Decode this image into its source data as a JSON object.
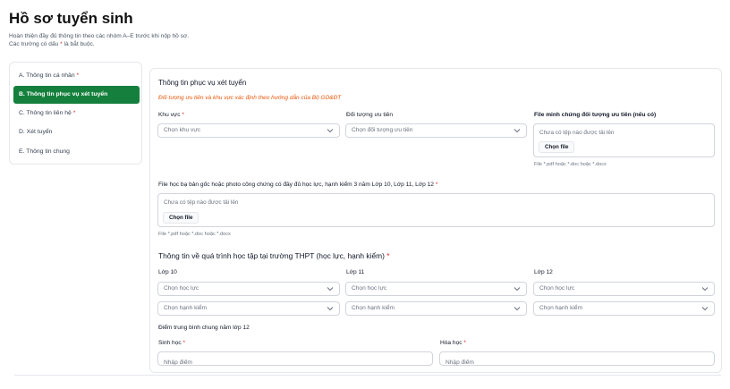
{
  "page": {
    "title": "Hồ sơ tuyển sinh",
    "desc_line1": "Hoàn thiện đầy đủ thông tin theo các nhóm A–E trước khi nộp hồ sơ.",
    "desc_line2_pre": "Các trường có dấu ",
    "desc_line2_star": "*",
    "desc_line2_post": " là bắt buộc."
  },
  "required_mark": "*",
  "sidebar": {
    "items": [
      {
        "label": "A. Thông tin cá nhân",
        "required": true
      },
      {
        "label": "B. Thông tin phục vụ xét tuyển",
        "active": true
      },
      {
        "label": "C. Thông tin liên hệ",
        "required": true
      },
      {
        "label": "D. Xét tuyển"
      },
      {
        "label": "E. Thông tin chung"
      }
    ]
  },
  "section1": {
    "title": "Thông tin phục vụ xét tuyển",
    "note": "Đối tượng ưu tiên và khu vực xác định theo hướng dẫn của Bộ GD&ĐT",
    "region_label": "Khu vực",
    "region_placeholder": "Chọn khu vực",
    "priority_label": "Đối tượng ưu tiên",
    "priority_placeholder": "Chọn đối tượng ưu tiên",
    "proof_label": "File minh chứng đối tượng ưu tiên (nếu có)",
    "proof_none": "Chưa có tệp nào được tải lên",
    "proof_button": "Chọn file",
    "proof_hint": "File *.pdf hoặc *.doc hoặc *.docx",
    "transcript_label": "File học bạ bản gốc hoặc photo công chứng có đầy đủ học lực, hạnh kiểm 3 năm Lớp 10, Lớp 11, Lớp 12",
    "transcript_none": "Chưa có tệp nào được tải lên",
    "transcript_button": "Chọn file",
    "transcript_hint": "File *.pdf hoặc *.doc hoặc *.docx"
  },
  "section2": {
    "title": "Thông tin về quá trình học tập tại trường THPT (học lực, hạnh kiểm)",
    "grades": [
      {
        "label": "Lớp 10",
        "academic_placeholder": "Chọn học lực",
        "conduct_placeholder": "Chọn hạnh kiểm"
      },
      {
        "label": "Lớp 11",
        "academic_placeholder": "Chọn học lực",
        "conduct_placeholder": "Chọn hạnh kiểm"
      },
      {
        "label": "Lớp 12",
        "academic_placeholder": "Chọn học lực",
        "conduct_placeholder": "Chọn hạnh kiểm"
      }
    ],
    "avg_title": "Điểm trung bình chung năm lớp 12",
    "biology_label": "Sinh học",
    "biology_placeholder": "Nhập điểm",
    "chemistry_label": "Hóa học",
    "chemistry_placeholder": "Nhập điểm"
  },
  "icons": {
    "select_chevron": "chevron-down-icon"
  },
  "colors": {
    "accent": "#15803d",
    "note": "#ea580c",
    "required": "#dc2626"
  }
}
